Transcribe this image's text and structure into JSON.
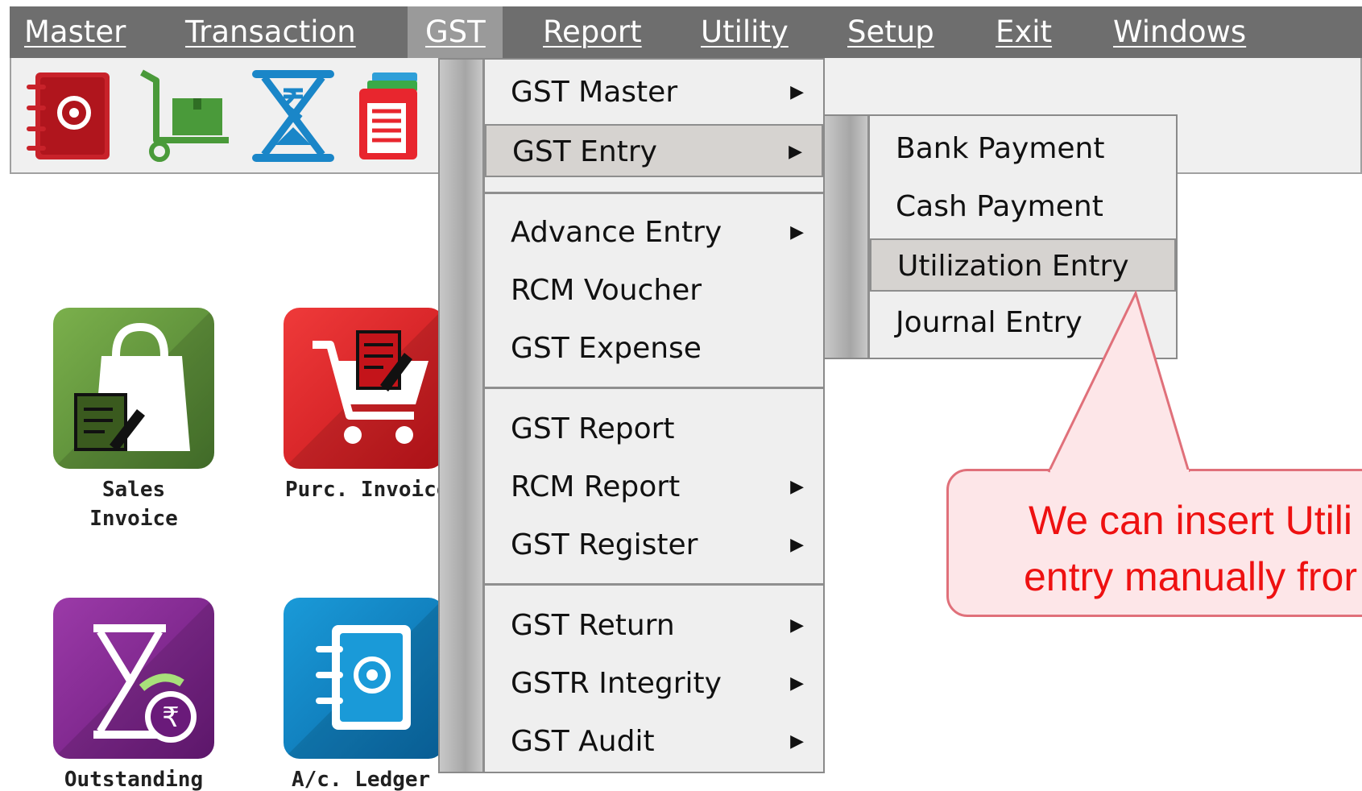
{
  "menubar": {
    "master": "Master",
    "transaction": "Transaction",
    "gst": "GST",
    "report": "Report",
    "utility": "Utility",
    "setup": "Setup",
    "exit": "Exit",
    "windows": "Windows"
  },
  "toolbar": {
    "icons": [
      "address-book-icon",
      "hand-truck-icon",
      "hourglass-rupee-icon",
      "register-book-icon"
    ]
  },
  "desktop": {
    "sales_invoice_line1": "Sales",
    "sales_invoice_line2": "Invoice",
    "purc_invoice": "Purc. Invoice",
    "outstanding": "Outstanding",
    "ac_ledger": "A/c. Ledger"
  },
  "gst_menu": {
    "items": [
      {
        "label": "GST Master",
        "submenu": true
      },
      {
        "label": "GST Entry",
        "submenu": true,
        "highlighted": true
      },
      {
        "label": "Advance Entry",
        "submenu": true
      },
      {
        "label": "RCM Voucher",
        "submenu": false
      },
      {
        "label": "GST Expense",
        "submenu": false
      },
      {
        "label": "GST Report",
        "submenu": false
      },
      {
        "label": "RCM Report",
        "submenu": true
      },
      {
        "label": "GST Register",
        "submenu": true
      },
      {
        "label": "GST Return",
        "submenu": true
      },
      {
        "label": "GSTR Integrity",
        "submenu": true
      },
      {
        "label": "GST Audit",
        "submenu": true
      }
    ]
  },
  "gst_entry_submenu": {
    "items": [
      {
        "label": "Bank Payment"
      },
      {
        "label": "Cash Payment"
      },
      {
        "label": "Utilization Entry",
        "highlighted": true
      },
      {
        "label": "Journal Entry"
      }
    ]
  },
  "callout": {
    "line1": "We can insert Utili",
    "line2": "entry manually fror"
  },
  "colors": {
    "menubar": "#6e6e6e",
    "menu_active": "#9a9a9a",
    "highlight": "#d6d3d0",
    "callout_fill": "#fde6e8",
    "callout_border": "#e0707a",
    "callout_text": "#ee1111"
  }
}
